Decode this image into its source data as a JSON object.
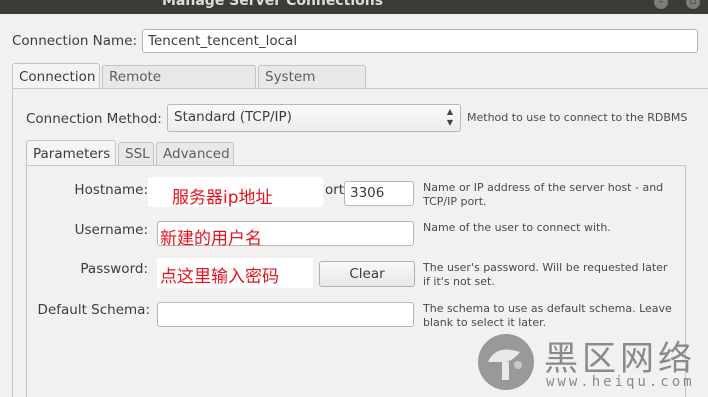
{
  "window": {
    "title": "Manage Server Connections"
  },
  "connection_name": {
    "label": "Connection Name:",
    "value": "Tencent_tencent_local"
  },
  "main_tabs": [
    {
      "label": "Connection",
      "active": true
    },
    {
      "label": "Remote Management",
      "active": false
    },
    {
      "label": "System Profile",
      "active": false
    }
  ],
  "connection_method": {
    "label": "Connection Method:",
    "value": "Standard (TCP/IP)",
    "help": "Method to use to connect to the RDBMS"
  },
  "sub_tabs": [
    {
      "label": "Parameters",
      "active": true
    },
    {
      "label": "SSL",
      "active": false
    },
    {
      "label": "Advanced",
      "active": false
    }
  ],
  "params": {
    "hostname": {
      "label": "Hostname:",
      "annotation": "服务器ip地址",
      "help": "Name or IP address of the server host - and TCP/IP port."
    },
    "port": {
      "label_fragment": "ort:",
      "value": "3306"
    },
    "username": {
      "label": "Username:",
      "annotation": "新建的用户名",
      "help": "Name of the user to connect with."
    },
    "password": {
      "label": "Password:",
      "annotation": "点这里输入密码",
      "clear_label": "Clear",
      "help": "The user's password. Will be requested later if it's not set."
    },
    "default_schema": {
      "label": "Default Schema:",
      "value": "",
      "help": "The schema to use as default schema. Leave blank to select it later."
    }
  },
  "watermark": {
    "title": "黑区网络",
    "url": "www.heiqu.com"
  },
  "colors": {
    "annotation_red": "#e8121e",
    "titlebar": "#3b3b38"
  }
}
